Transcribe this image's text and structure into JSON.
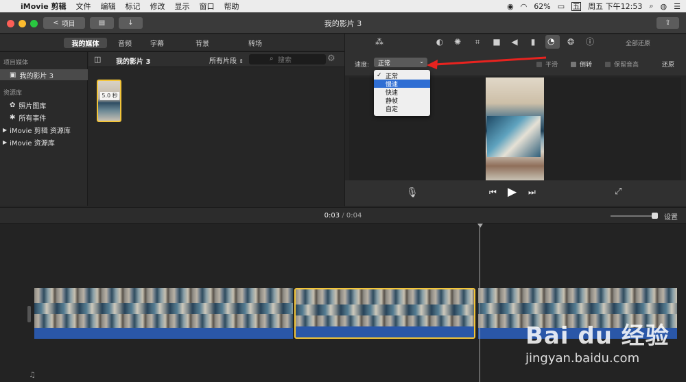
{
  "menubar": {
    "app_name": "iMovie 剪辑",
    "items": [
      "文件",
      "编辑",
      "标记",
      "修改",
      "显示",
      "窗口",
      "帮助"
    ],
    "battery": "62%",
    "input_method": "五",
    "clock": "周五 下午12:53"
  },
  "toolbar": {
    "back_label": "项目",
    "window_title": "我的影片 3"
  },
  "tabs": [
    "我的媒体",
    "音频",
    "字幕",
    "背景",
    "转场"
  ],
  "sidebar": {
    "section_project": "项目媒体",
    "project_item": "我的影片 3",
    "section_library": "资源库",
    "items": [
      "照片图库",
      "所有事件",
      "iMovie 剪辑 资源库",
      "iMovie 资源库"
    ]
  },
  "browser": {
    "title": "我的影片 3",
    "filter": "所有片段",
    "search_placeholder": "搜索",
    "clip_duration": "5.0 秒"
  },
  "viewer": {
    "reset_all": "全部还原",
    "speed_label": "速度:",
    "speed_value": "正常",
    "speed_options": [
      "正常",
      "慢速",
      "快速",
      "静帧",
      "自定"
    ],
    "smooth_label": "平滑",
    "reverse_label": "倒转",
    "preserve_pitch_label": "保留音高",
    "reset_label": "还原"
  },
  "timeline": {
    "current_time": "0:03",
    "separator": "/",
    "total_time": "0:04",
    "settings_label": "设置"
  },
  "watermark": {
    "logo": "Bai du 经验",
    "url": "jingyan.baidu.com"
  },
  "colors": {
    "selection_yellow": "#f3c53a",
    "menu_highlight": "#2f6ed3",
    "arrow_red": "#e8231f"
  }
}
